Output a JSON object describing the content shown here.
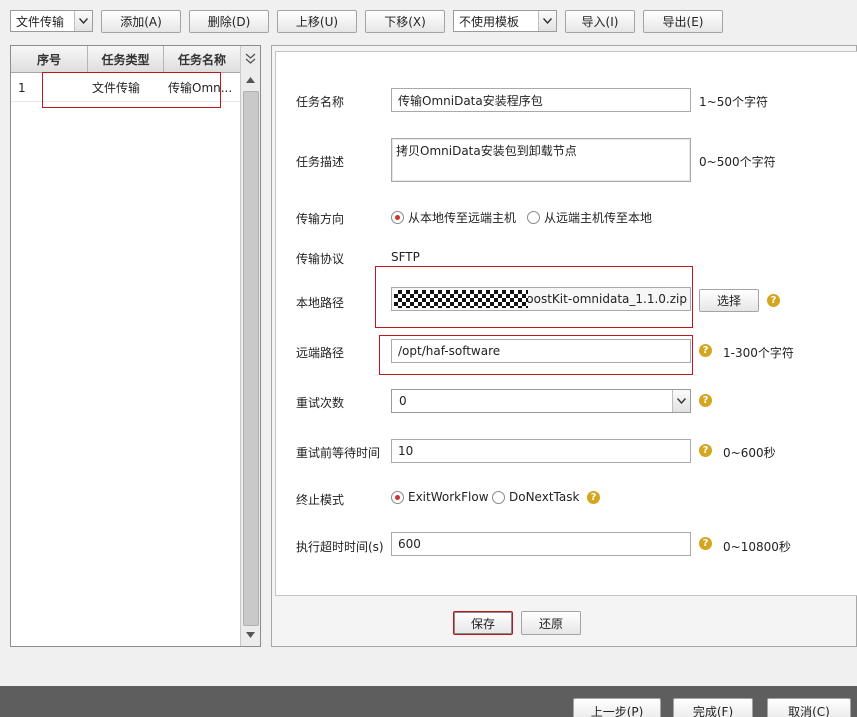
{
  "toolbar": {
    "task_type_select": "文件传输",
    "add": "添加(A)",
    "delete": "删除(D)",
    "move_up": "上移(U)",
    "move_down": "下移(X)",
    "template_select": "不使用模板",
    "import": "导入(I)",
    "export": "导出(E)"
  },
  "task_list": {
    "columns": [
      "序号",
      "任务类型",
      "任务名称"
    ],
    "rows": [
      {
        "index": "1",
        "type": "文件传输",
        "name": "传输Omn..."
      }
    ]
  },
  "form": {
    "task_name": {
      "label": "任务名称",
      "value": "传输OmniData安装程序包",
      "hint": "1~50个字符"
    },
    "task_desc": {
      "label": "任务描述",
      "value": "拷贝OmniData安装包到卸载节点",
      "hint": "0~500个字符"
    },
    "direction": {
      "label": "传输方向",
      "options": [
        "从本地传至远端主机",
        "从远端主机传至本地"
      ],
      "selected": 0
    },
    "protocol": {
      "label": "传输协议",
      "value": "SFTP"
    },
    "local_path": {
      "label": "本地路径",
      "value": "\\BoostKit-omnidata_1.1.0.zip",
      "button": "选择"
    },
    "remote_path": {
      "label": "远端路径",
      "value": "/opt/haf-software",
      "hint": "1-300个字符"
    },
    "retry_count": {
      "label": "重试次数",
      "value": "0"
    },
    "retry_wait": {
      "label": "重试前等待时间",
      "value": "10",
      "hint": "0~600秒"
    },
    "stop_mode": {
      "label": "终止模式",
      "options": [
        "ExitWorkFlow",
        "DoNextTask"
      ],
      "selected": 0
    },
    "timeout": {
      "label": "执行超时时间(s)",
      "value": "600",
      "hint": "0~10800秒"
    },
    "save": "保存",
    "restore": "还原"
  },
  "footer": {
    "prev": "上一步(P)",
    "finish": "完成(F)",
    "cancel": "取消(C)"
  },
  "colors": {
    "highlight_red": "#c0161d",
    "help_icon": "#d3a520",
    "bottom_bar": "#5e5e5e"
  }
}
